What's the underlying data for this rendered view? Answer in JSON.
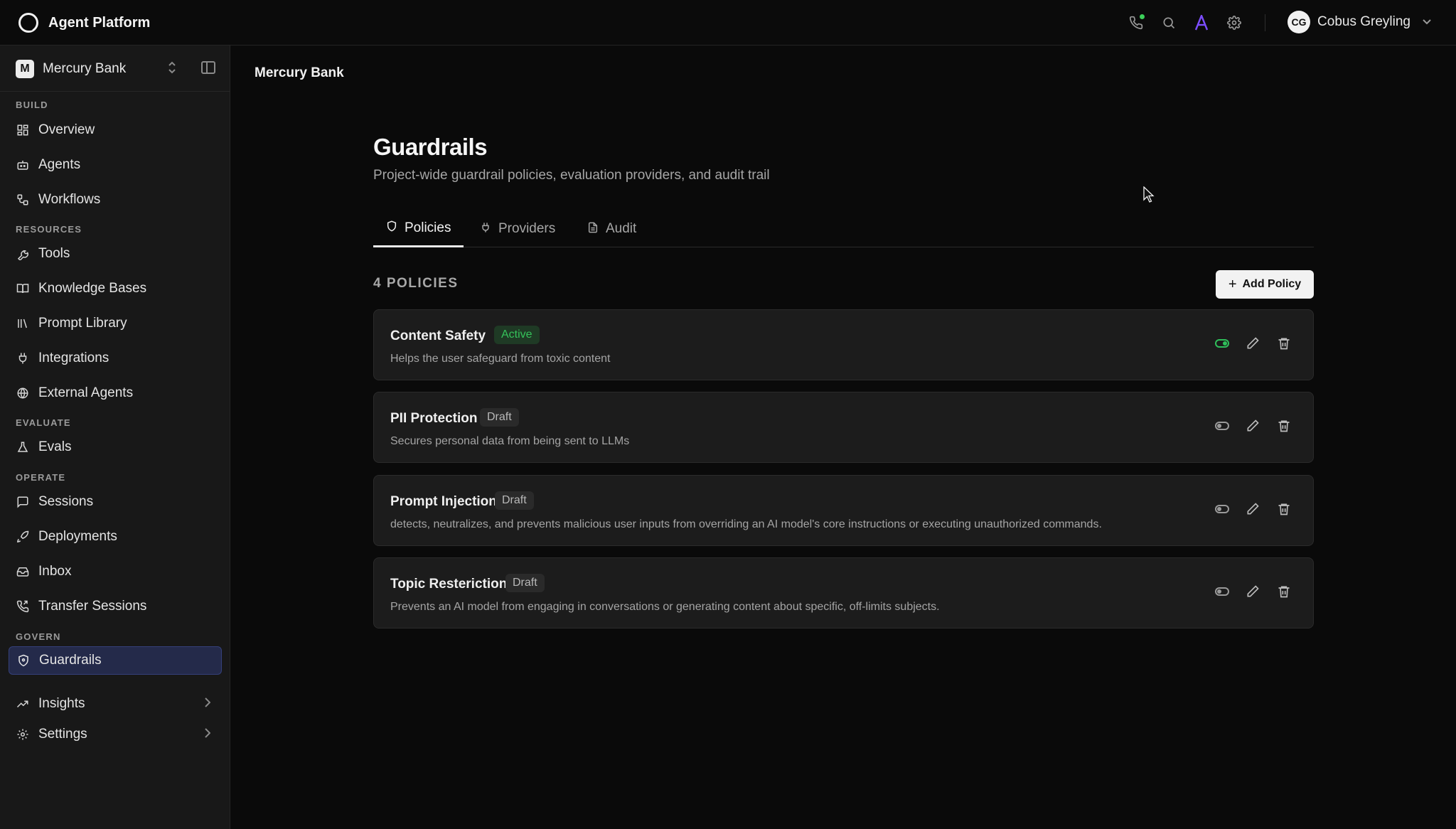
{
  "app": {
    "name": "Agent Platform"
  },
  "user": {
    "initials": "CG",
    "name": "Cobus Greyling"
  },
  "top_icons": [
    "phone-icon",
    "search-icon",
    "assistant-icon",
    "gear-icon"
  ],
  "project": {
    "initial": "M",
    "name": "Mercury Bank"
  },
  "sidebar": {
    "sections": {
      "build": "BUILD",
      "resources": "RESOURCES",
      "evaluate": "EVALUATE",
      "operate": "OPERATE",
      "govern": "GOVERN"
    },
    "items": [
      {
        "label": "Overview"
      },
      {
        "label": "Agents"
      },
      {
        "label": "Workflows"
      },
      {
        "label": "Tools"
      },
      {
        "label": "Knowledge Bases"
      },
      {
        "label": "Prompt Library"
      },
      {
        "label": "Integrations"
      },
      {
        "label": "External Agents"
      },
      {
        "label": "Evals"
      },
      {
        "label": "Sessions"
      },
      {
        "label": "Deployments"
      },
      {
        "label": "Inbox"
      },
      {
        "label": "Transfer Sessions"
      },
      {
        "label": "Guardrails"
      },
      {
        "label": "Insights"
      },
      {
        "label": "Settings"
      }
    ],
    "active": "Guardrails"
  },
  "breadcrumb": "Mercury Bank",
  "page": {
    "title": "Guardrails",
    "subtitle": "Project-wide guardrail policies, evaluation providers, and audit trail"
  },
  "tabs": [
    {
      "label": "Policies",
      "active": true
    },
    {
      "label": "Providers",
      "active": false
    },
    {
      "label": "Audit",
      "active": false
    }
  ],
  "policies_count_label": "4 POLICIES",
  "add_policy_label": "Add Policy",
  "policies": [
    {
      "name": "Content Safety",
      "status": "Active",
      "enabled": true,
      "description": "Helps the user safeguard from toxic content"
    },
    {
      "name": "PII Protection",
      "status": "Draft",
      "enabled": false,
      "description": "Secures personal data from being sent to LLMs"
    },
    {
      "name": "Prompt Injection",
      "status": "Draft",
      "enabled": false,
      "description": "detects, neutralizes, and prevents malicious user inputs from overriding an AI model's core instructions or executing unauthorized commands."
    },
    {
      "name": "Topic Resterictio​n",
      "status": "Draft",
      "enabled": false,
      "description": "Prevents an AI model from engaging in conversations or generating content about specific, off-limits subjects."
    }
  ],
  "colors": {
    "accent": "#7c4dff",
    "active_green": "#35c25a",
    "active_nav": "#242a4a"
  }
}
